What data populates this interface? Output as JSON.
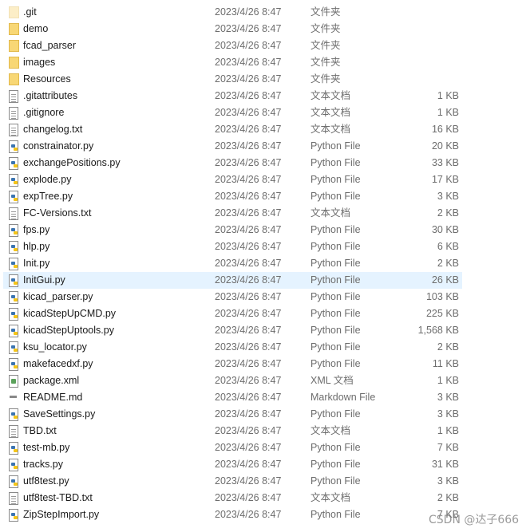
{
  "files": [
    {
      "name": ".git",
      "date": "2023/4/26 8:47",
      "type": "文件夹",
      "size": "",
      "icon": "folder-faded"
    },
    {
      "name": "demo",
      "date": "2023/4/26 8:47",
      "type": "文件夹",
      "size": "",
      "icon": "folder"
    },
    {
      "name": "fcad_parser",
      "date": "2023/4/26 8:47",
      "type": "文件夹",
      "size": "",
      "icon": "folder"
    },
    {
      "name": "images",
      "date": "2023/4/26 8:47",
      "type": "文件夹",
      "size": "",
      "icon": "folder"
    },
    {
      "name": "Resources",
      "date": "2023/4/26 8:47",
      "type": "文件夹",
      "size": "",
      "icon": "folder"
    },
    {
      "name": ".gitattributes",
      "date": "2023/4/26 8:47",
      "type": "文本文档",
      "size": "1 KB",
      "icon": "doc"
    },
    {
      "name": ".gitignore",
      "date": "2023/4/26 8:47",
      "type": "文本文档",
      "size": "1 KB",
      "icon": "doc"
    },
    {
      "name": "changelog.txt",
      "date": "2023/4/26 8:47",
      "type": "文本文档",
      "size": "16 KB",
      "icon": "doc"
    },
    {
      "name": "constrainator.py",
      "date": "2023/4/26 8:47",
      "type": "Python File",
      "size": "20 KB",
      "icon": "py"
    },
    {
      "name": "exchangePositions.py",
      "date": "2023/4/26 8:47",
      "type": "Python File",
      "size": "33 KB",
      "icon": "py"
    },
    {
      "name": "explode.py",
      "date": "2023/4/26 8:47",
      "type": "Python File",
      "size": "17 KB",
      "icon": "py"
    },
    {
      "name": "expTree.py",
      "date": "2023/4/26 8:47",
      "type": "Python File",
      "size": "3 KB",
      "icon": "py"
    },
    {
      "name": "FC-Versions.txt",
      "date": "2023/4/26 8:47",
      "type": "文本文档",
      "size": "2 KB",
      "icon": "doc"
    },
    {
      "name": "fps.py",
      "date": "2023/4/26 8:47",
      "type": "Python File",
      "size": "30 KB",
      "icon": "py"
    },
    {
      "name": "hlp.py",
      "date": "2023/4/26 8:47",
      "type": "Python File",
      "size": "6 KB",
      "icon": "py"
    },
    {
      "name": "Init.py",
      "date": "2023/4/26 8:47",
      "type": "Python File",
      "size": "2 KB",
      "icon": "py"
    },
    {
      "name": "InitGui.py",
      "date": "2023/4/26 8:47",
      "type": "Python File",
      "size": "26 KB",
      "icon": "py",
      "selected": true
    },
    {
      "name": "kicad_parser.py",
      "date": "2023/4/26 8:47",
      "type": "Python File",
      "size": "103 KB",
      "icon": "py"
    },
    {
      "name": "kicadStepUpCMD.py",
      "date": "2023/4/26 8:47",
      "type": "Python File",
      "size": "225 KB",
      "icon": "py"
    },
    {
      "name": "kicadStepUptools.py",
      "date": "2023/4/26 8:47",
      "type": "Python File",
      "size": "1,568 KB",
      "icon": "py"
    },
    {
      "name": "ksu_locator.py",
      "date": "2023/4/26 8:47",
      "type": "Python File",
      "size": "2 KB",
      "icon": "py"
    },
    {
      "name": "makefacedxf.py",
      "date": "2023/4/26 8:47",
      "type": "Python File",
      "size": "11 KB",
      "icon": "py"
    },
    {
      "name": "package.xml",
      "date": "2023/4/26 8:47",
      "type": "XML 文档",
      "size": "1 KB",
      "icon": "xml"
    },
    {
      "name": "README.md",
      "date": "2023/4/26 8:47",
      "type": "Markdown File",
      "size": "3 KB",
      "icon": "md"
    },
    {
      "name": "SaveSettings.py",
      "date": "2023/4/26 8:47",
      "type": "Python File",
      "size": "3 KB",
      "icon": "py"
    },
    {
      "name": "TBD.txt",
      "date": "2023/4/26 8:47",
      "type": "文本文档",
      "size": "1 KB",
      "icon": "doc"
    },
    {
      "name": "test-mb.py",
      "date": "2023/4/26 8:47",
      "type": "Python File",
      "size": "7 KB",
      "icon": "py"
    },
    {
      "name": "tracks.py",
      "date": "2023/4/26 8:47",
      "type": "Python File",
      "size": "31 KB",
      "icon": "py"
    },
    {
      "name": "utf8test.py",
      "date": "2023/4/26 8:47",
      "type": "Python File",
      "size": "3 KB",
      "icon": "py"
    },
    {
      "name": "utf8test-TBD.txt",
      "date": "2023/4/26 8:47",
      "type": "文本文档",
      "size": "2 KB",
      "icon": "doc"
    },
    {
      "name": "ZipStepImport.py",
      "date": "2023/4/26 8:47",
      "type": "Python File",
      "size": "7 KB",
      "icon": "py"
    }
  ],
  "watermark": "CSDN @达子666"
}
